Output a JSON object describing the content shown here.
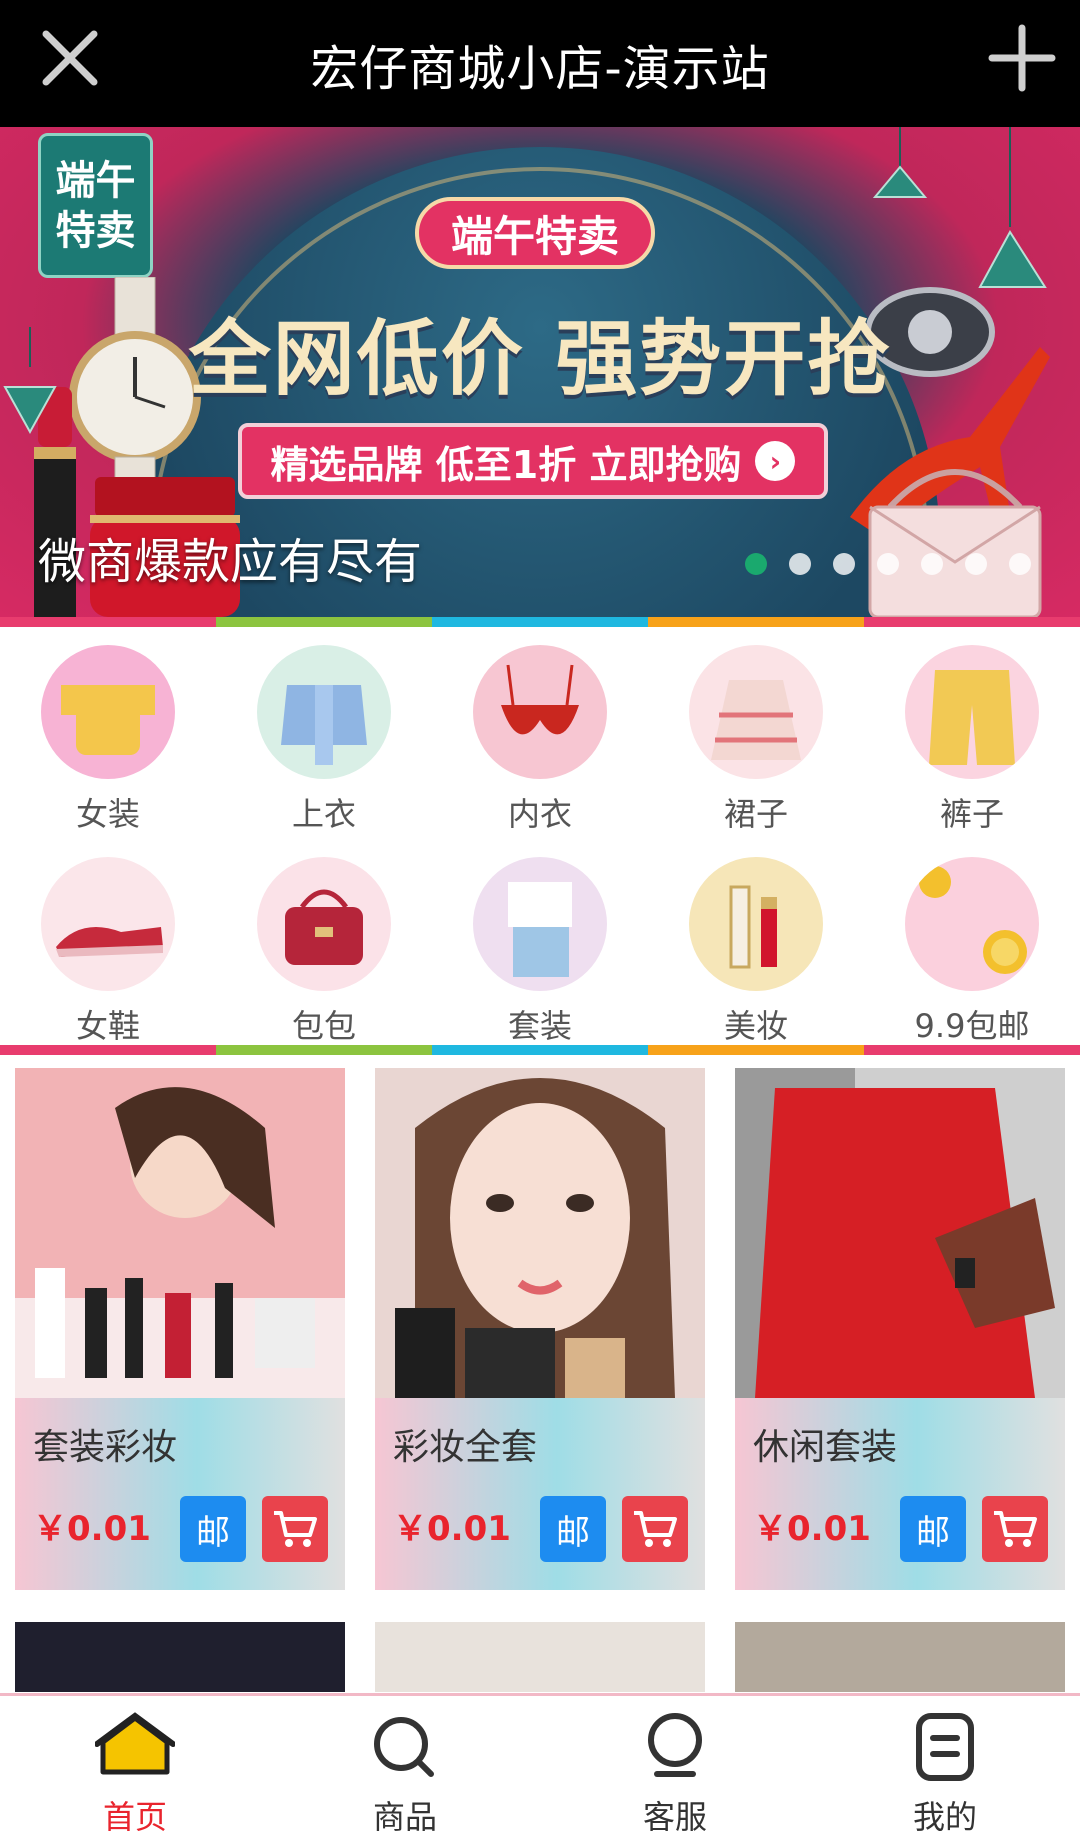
{
  "header": {
    "title": "宏仔商城小店-演示站",
    "close_icon": "close-icon",
    "add_icon": "plus-icon"
  },
  "banner": {
    "tag_line1": "端午",
    "tag_line2": "特卖",
    "badge": "端午特卖",
    "headline": "全网低价 强势开抢",
    "cta": "精选品牌 低至1折 立即抢购",
    "caption": "微商爆款应有尽有",
    "slide_count": 7,
    "active_slide": 1
  },
  "colors": {
    "stripe": [
      "#e83c6e",
      "#8cc43f",
      "#1fb8e0",
      "#f7a21a",
      "#e83c6e"
    ],
    "accent_red": "#e9242d",
    "mail_blue": "#1d8cf0",
    "cart_red": "#e9434c"
  },
  "categories": [
    {
      "label": "女装",
      "bg": "#f7b3d4"
    },
    {
      "label": "上衣",
      "bg": "#d9efe6"
    },
    {
      "label": "内衣",
      "bg": "#f7c6d2"
    },
    {
      "label": "裙子",
      "bg": "#fbe3e6"
    },
    {
      "label": "裤子",
      "bg": "#fbd4e0"
    },
    {
      "label": "女鞋",
      "bg": "#fbe6ea"
    },
    {
      "label": "包包",
      "bg": "#fbe2e8"
    },
    {
      "label": "套装",
      "bg": "#efdff0"
    },
    {
      "label": "美妆",
      "bg": "#f6e6b8"
    },
    {
      "label": "9.9包邮",
      "bg": "#fbd0dd"
    }
  ],
  "products": [
    {
      "name": "套装彩妆",
      "price": "￥0.01",
      "mail_label": "邮"
    },
    {
      "name": "彩妆全套",
      "price": "￥0.01",
      "mail_label": "邮"
    },
    {
      "name": "休闲套装",
      "price": "￥0.01",
      "mail_label": "邮"
    }
  ],
  "bottom_nav": [
    {
      "label": "首页",
      "icon": "home-icon",
      "active": true
    },
    {
      "label": "商品",
      "icon": "search-icon",
      "active": false
    },
    {
      "label": "客服",
      "icon": "service-icon",
      "active": false
    },
    {
      "label": "我的",
      "icon": "profile-icon",
      "active": false
    }
  ]
}
